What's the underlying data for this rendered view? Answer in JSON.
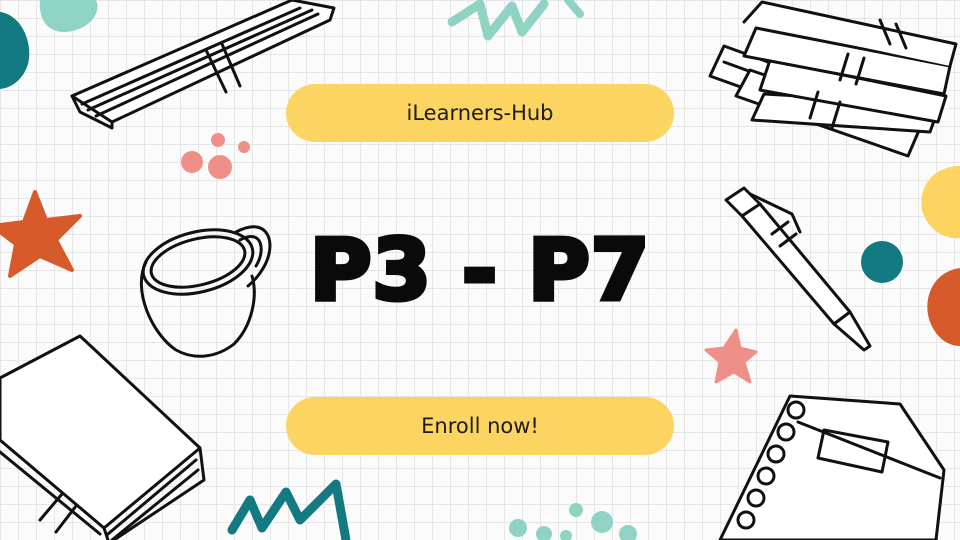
{
  "banner": {
    "brand_label": "iLearners-Hub",
    "headline": "P3 - P7",
    "cta_label": "Enroll now!"
  },
  "colors": {
    "pill": "#fcd462",
    "teal": "#147a82",
    "mint": "#8fd3c4",
    "orange": "#d65a2a",
    "salmon": "#ef9088",
    "grid_bg": "#fbfbfb",
    "ink": "#111111"
  },
  "icons": [
    "book-icon",
    "book-stack-icon",
    "coffee-mug-icon",
    "pen-icon",
    "spiral-notebook-icon",
    "star-icon",
    "scribble-icon",
    "dots-icon",
    "blob-icon"
  ]
}
